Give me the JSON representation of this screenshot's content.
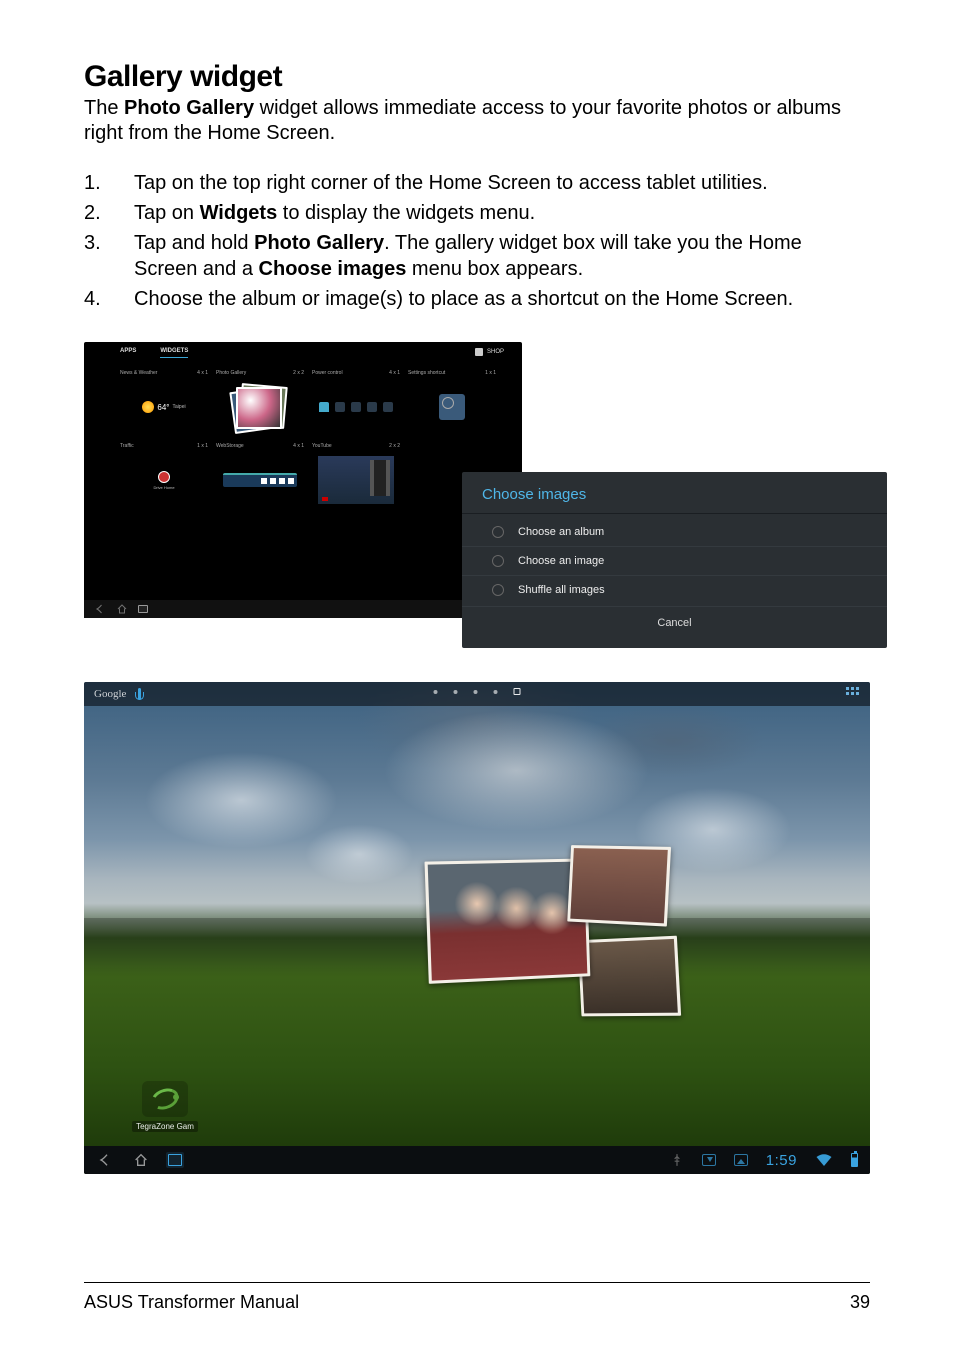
{
  "title": "Gallery widget",
  "intro_pre": "The ",
  "intro_bold": "Photo Gallery",
  "intro_post": " widget allows immediate access to your favorite photos or albums right from the Home Screen.",
  "steps": [
    {
      "num": "1.",
      "text": "Tap on the top right corner of the Home Screen to access tablet utilities."
    },
    {
      "num": "2.",
      "pre": "Tap on ",
      "b1": "Widgets",
      "post": " to display the widgets menu."
    },
    {
      "num": "3.",
      "pre": "Tap and hold ",
      "b1": "Photo Gallery",
      "mid": ". The gallery widget box will take you the Home Screen and a ",
      "b2": "Choose images",
      "post": " menu box appears."
    },
    {
      "num": "4.",
      "text": "Choose the album or image(s) to place as a shortcut on the Home Screen."
    }
  ],
  "ss1": {
    "tabs": {
      "apps": "APPS",
      "widgets": "WIDGETS"
    },
    "shop_label": "SHOP",
    "widgets": {
      "news": {
        "label": "News & Weather",
        "size": "4 x 1",
        "temp": "64°",
        "city": "Taipei"
      },
      "photo": {
        "label": "Photo Gallery",
        "size": "2 x 2"
      },
      "power": {
        "label": "Power control",
        "size": "4 x 1"
      },
      "settings": {
        "label": "Settings shortcut",
        "size": "1 x 1"
      },
      "traffic": {
        "label": "Traffic",
        "size": "1 x 1",
        "sub": "Drive Home"
      },
      "webstorage": {
        "label": "WebStorage",
        "size": "4 x 1"
      },
      "youtube": {
        "label": "YouTube",
        "size": "2 x 2"
      }
    },
    "dialog": {
      "title": "Choose images",
      "opts": [
        "Choose an album",
        "Choose an image",
        "Shuffle all images"
      ],
      "cancel": "Cancel"
    }
  },
  "ss2": {
    "google": "Google",
    "tegra": "TegraZone Gam",
    "clock": "1:59"
  },
  "footer": {
    "left": "ASUS Transformer Manual",
    "right": "39"
  }
}
